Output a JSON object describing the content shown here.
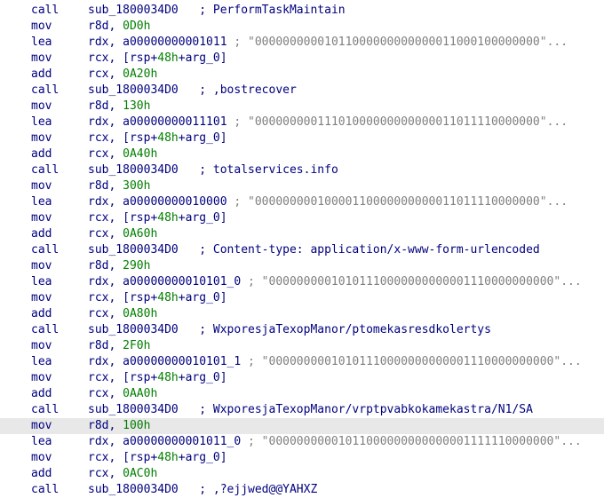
{
  "listing": {
    "lines": [
      {
        "mnemonic": "call",
        "parts": [
          {
            "t": "sub_1800034D0",
            "c": "plain"
          },
          {
            "t": "   ; ",
            "c": "plain"
          },
          {
            "t": "PerformTaskMaintain",
            "c": "plain"
          }
        ]
      },
      {
        "mnemonic": "mov",
        "parts": [
          {
            "t": "r8d, ",
            "c": "plain"
          },
          {
            "t": "0D0h",
            "c": "num"
          }
        ]
      },
      {
        "mnemonic": "lea",
        "parts": [
          {
            "t": "rdx, a00000000001011 ",
            "c": "plain"
          },
          {
            "t": "; \"00000000001011000000000000011000100000000\"...",
            "c": "cmt-str"
          }
        ]
      },
      {
        "mnemonic": "mov",
        "parts": [
          {
            "t": "rcx, [rsp+",
            "c": "plain"
          },
          {
            "t": "48h",
            "c": "num"
          },
          {
            "t": "+arg_0]",
            "c": "plain"
          }
        ]
      },
      {
        "mnemonic": "add",
        "parts": [
          {
            "t": "rcx, ",
            "c": "plain"
          },
          {
            "t": "0A20h",
            "c": "num"
          }
        ]
      },
      {
        "mnemonic": "call",
        "parts": [
          {
            "t": "sub_1800034D0",
            "c": "plain"
          },
          {
            "t": "   ; ",
            "c": "plain"
          },
          {
            "t": ",bostrecover",
            "c": "plain"
          }
        ]
      },
      {
        "mnemonic": "mov",
        "parts": [
          {
            "t": "r8d, ",
            "c": "plain"
          },
          {
            "t": "130h",
            "c": "num"
          }
        ]
      },
      {
        "mnemonic": "lea",
        "parts": [
          {
            "t": "rdx, a00000000011101 ",
            "c": "plain"
          },
          {
            "t": "; \"00000000011101000000000000011011110000000\"...",
            "c": "cmt-str"
          }
        ]
      },
      {
        "mnemonic": "mov",
        "parts": [
          {
            "t": "rcx, [rsp+",
            "c": "plain"
          },
          {
            "t": "48h",
            "c": "num"
          },
          {
            "t": "+arg_0]",
            "c": "plain"
          }
        ]
      },
      {
        "mnemonic": "add",
        "parts": [
          {
            "t": "rcx, ",
            "c": "plain"
          },
          {
            "t": "0A40h",
            "c": "num"
          }
        ]
      },
      {
        "mnemonic": "call",
        "parts": [
          {
            "t": "sub_1800034D0",
            "c": "plain"
          },
          {
            "t": "   ; ",
            "c": "plain"
          },
          {
            "t": "totalservices.info",
            "c": "plain"
          }
        ]
      },
      {
        "mnemonic": "mov",
        "parts": [
          {
            "t": "r8d, ",
            "c": "plain"
          },
          {
            "t": "300h",
            "c": "num"
          }
        ]
      },
      {
        "mnemonic": "lea",
        "parts": [
          {
            "t": "rdx, a00000000010000 ",
            "c": "plain"
          },
          {
            "t": "; \"00000000010000110000000000011011110000000\"...",
            "c": "cmt-str"
          }
        ]
      },
      {
        "mnemonic": "mov",
        "parts": [
          {
            "t": "rcx, [rsp+",
            "c": "plain"
          },
          {
            "t": "48h",
            "c": "num"
          },
          {
            "t": "+arg_0]",
            "c": "plain"
          }
        ]
      },
      {
        "mnemonic": "add",
        "parts": [
          {
            "t": "rcx, ",
            "c": "plain"
          },
          {
            "t": "0A60h",
            "c": "num"
          }
        ]
      },
      {
        "mnemonic": "call",
        "parts": [
          {
            "t": "sub_1800034D0",
            "c": "plain"
          },
          {
            "t": "   ; ",
            "c": "plain"
          },
          {
            "t": "Content-type: application/x-www-form-urlencoded",
            "c": "plain"
          }
        ]
      },
      {
        "mnemonic": "mov",
        "parts": [
          {
            "t": "r8d, ",
            "c": "plain"
          },
          {
            "t": "290h",
            "c": "num"
          }
        ]
      },
      {
        "mnemonic": "lea",
        "parts": [
          {
            "t": "rdx, a00000000010101_0 ",
            "c": "plain"
          },
          {
            "t": "; \"00000000010101110000000000001110000000000\"...",
            "c": "cmt-str"
          }
        ]
      },
      {
        "mnemonic": "mov",
        "parts": [
          {
            "t": "rcx, [rsp+",
            "c": "plain"
          },
          {
            "t": "48h",
            "c": "num"
          },
          {
            "t": "+arg_0]",
            "c": "plain"
          }
        ]
      },
      {
        "mnemonic": "add",
        "parts": [
          {
            "t": "rcx, ",
            "c": "plain"
          },
          {
            "t": "0A80h",
            "c": "num"
          }
        ]
      },
      {
        "mnemonic": "call",
        "parts": [
          {
            "t": "sub_1800034D0",
            "c": "plain"
          },
          {
            "t": "   ; ",
            "c": "plain"
          },
          {
            "t": "WxporesjaTexopManor/ptomekasresdkolertys",
            "c": "plain"
          }
        ]
      },
      {
        "mnemonic": "mov",
        "parts": [
          {
            "t": "r8d, ",
            "c": "plain"
          },
          {
            "t": "2F0h",
            "c": "num"
          }
        ]
      },
      {
        "mnemonic": "lea",
        "parts": [
          {
            "t": "rdx, a00000000010101_1 ",
            "c": "plain"
          },
          {
            "t": "; \"00000000010101110000000000001110000000000\"...",
            "c": "cmt-str"
          }
        ]
      },
      {
        "mnemonic": "mov",
        "parts": [
          {
            "t": "rcx, [rsp+",
            "c": "plain"
          },
          {
            "t": "48h",
            "c": "num"
          },
          {
            "t": "+arg_0]",
            "c": "plain"
          }
        ]
      },
      {
        "mnemonic": "add",
        "parts": [
          {
            "t": "rcx, ",
            "c": "plain"
          },
          {
            "t": "0AA0h",
            "c": "num"
          }
        ]
      },
      {
        "mnemonic": "call",
        "parts": [
          {
            "t": "sub_1800034D0",
            "c": "plain"
          },
          {
            "t": "   ; ",
            "c": "plain"
          },
          {
            "t": "WxporesjaTexopManor/vrptpvabkokamekastra/N1/SA",
            "c": "plain"
          }
        ]
      },
      {
        "mnemonic": "mov",
        "highlight": true,
        "parts": [
          {
            "t": "r8d, ",
            "c": "plain"
          },
          {
            "t": "100h",
            "c": "num"
          }
        ]
      },
      {
        "mnemonic": "lea",
        "parts": [
          {
            "t": "rdx, a00000000001011_0 ",
            "c": "plain"
          },
          {
            "t": "; \"00000000001011000000000000001111110000000\"...",
            "c": "cmt-str"
          }
        ]
      },
      {
        "mnemonic": "mov",
        "parts": [
          {
            "t": "rcx, [rsp+",
            "c": "plain"
          },
          {
            "t": "48h",
            "c": "num"
          },
          {
            "t": "+arg_0]",
            "c": "plain"
          }
        ]
      },
      {
        "mnemonic": "add",
        "parts": [
          {
            "t": "rcx, ",
            "c": "plain"
          },
          {
            "t": "0AC0h",
            "c": "num"
          }
        ]
      },
      {
        "mnemonic": "call",
        "parts": [
          {
            "t": "sub_1800034D0",
            "c": "plain"
          },
          {
            "t": "   ; ",
            "c": "plain"
          },
          {
            "t": ",?ejjwed@@YAHXZ",
            "c": "plain"
          }
        ]
      }
    ]
  },
  "colors": {
    "text": "#00007f",
    "number": "#007f00",
    "comment_string": "#7f7f7f",
    "highlight_row": "#e8e8e8",
    "background": "#ffffff"
  }
}
